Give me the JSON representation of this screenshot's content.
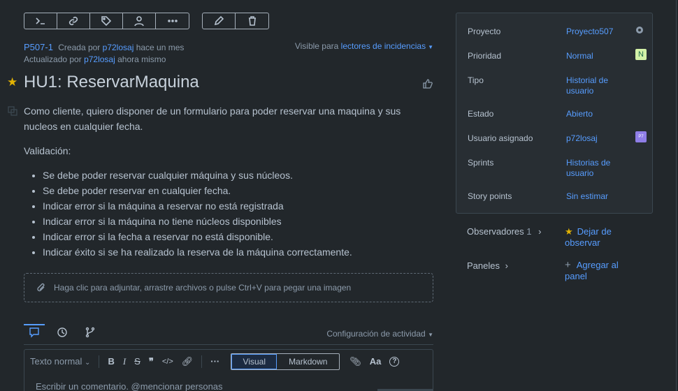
{
  "toolbar": {
    "buttons": [
      "terminal-icon",
      "link-icon",
      "tag-icon",
      "assign-user-icon",
      "more-icon"
    ],
    "edit": [
      "pencil-icon",
      "trash-icon"
    ]
  },
  "issue": {
    "key": "P507-1",
    "created_prefix": "Creada por",
    "created_by": "p72losaj",
    "created_when": "hace un mes",
    "updated_prefix": "Actualizado por",
    "updated_by": "p72losaj",
    "updated_when": "ahora mismo",
    "visibility_prefix": "Visible para",
    "visibility_value": "lectores de incidencias",
    "title": "HU1: ReservarMaquina"
  },
  "description": {
    "paragraph": "Como cliente, quiero disponer de un formulario para poder reservar una maquina y sus nucleos en cualquier fecha.",
    "validation_label": "Validación:",
    "items": [
      "Se debe poder reservar cualquier máquina y sus núcleos.",
      "Se debe poder reservar en cualquier fecha.",
      "Indicar error si la máquina a reservar no está registrada",
      "Indicar error si la máquina no tiene núcleos disponibles",
      "Indicar error si la fecha a reservar no está disponible.",
      "Indicar éxito si se ha realizado la reserva de la máquina correctamente."
    ]
  },
  "attach": {
    "text": "Haga clic para adjuntar, arrastre archivos o pulse Ctrl+V para pegar una imagen"
  },
  "activity": {
    "config_label": "Configuración de actividad"
  },
  "editor": {
    "text_style": "Texto normal",
    "mode_visual": "Visual",
    "mode_markdown": "Markdown",
    "font_label": "Aa",
    "placeholder": "Escribir un comentario. @mencionar personas"
  },
  "fields": [
    {
      "label": "Proyecto",
      "value": "Proyecto507"
    },
    {
      "label": "Prioridad",
      "value": "Normal",
      "badge": "N"
    },
    {
      "label": "Tipo",
      "value": "Historial de usuario"
    },
    {
      "label": "Estado",
      "value": "Abierto"
    },
    {
      "label": "Usuario asignado",
      "value": "p72losaj",
      "avatar": "P7"
    },
    {
      "label": "Sprints",
      "value": "Historias de usuario"
    },
    {
      "label": "Story points",
      "value": "Sin estimar"
    }
  ],
  "watchers": {
    "label": "Observadores",
    "count": "1",
    "action": "Dejar de observar"
  },
  "boards": {
    "label": "Paneles",
    "action": "Agregar al panel"
  },
  "colors": {
    "accent": "#579dff",
    "star": "#e2b203",
    "background": "#22272b"
  }
}
